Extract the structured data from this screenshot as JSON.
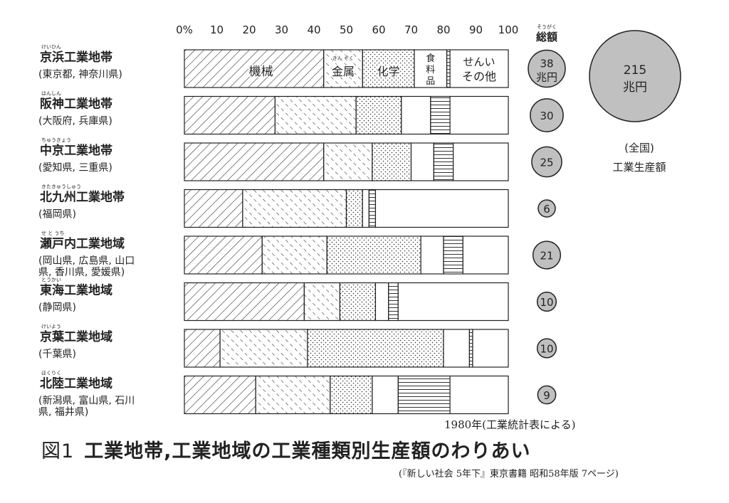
{
  "title": "図1",
  "title_text": "工業地帯,工業地域の工業種類別生産額のわりあい",
  "source_note": "1980年(工業統計表による)",
  "citation": "(『新しい社会 5年下』東京書籍 昭和58年版 7ページ)",
  "total_header": "総額",
  "total_header_ruby": "そうがく",
  "national": {
    "value": "215",
    "unit": "兆円",
    "caption": "(全国)",
    "label": "工業生産額"
  },
  "chart_data": {
    "type": "bar",
    "orientation": "horizontal-stacked-100",
    "x_ticks": [
      "0%",
      "10",
      "20",
      "30",
      "40",
      "50",
      "60",
      "70",
      "80",
      "90",
      "100"
    ],
    "xlim": [
      0,
      100
    ],
    "segment_labels": {
      "machinery": "機械",
      "metal": "金属",
      "metal_ruby": "きん ぞく",
      "chemical": "化学",
      "food": "食料品",
      "textile": "せんい",
      "other": "その他"
    },
    "categories": [
      {
        "name": "京浜工業地帯",
        "ruby": "けいひん",
        "sub": "(東京都, 神奈川県)",
        "total": "38",
        "total_unit": "兆円"
      },
      {
        "name": "阪神工業地帯",
        "ruby": "はんしん",
        "sub": "(大阪府, 兵庫県)",
        "total": "30"
      },
      {
        "name": "中京工業地帯",
        "ruby": "ちゅうきょう",
        "sub": "(愛知県, 三重県)",
        "total": "25"
      },
      {
        "name": "北九州工業地帯",
        "ruby": "きたきゅうしゅう",
        "sub": "(福岡県)",
        "total": "6"
      },
      {
        "name": "瀬戸内工業地域",
        "ruby": "せ と うち",
        "sub": "(岡山県, 広島県, 山口",
        "sub2": "県, 香川県, 愛媛県)",
        "total": "21"
      },
      {
        "name": "東海工業地域",
        "ruby": "とうかい",
        "sub": "(静岡県)",
        "total": "10"
      },
      {
        "name": "京葉工業地域",
        "ruby": "けいよう",
        "sub": "(千葉県)",
        "total": "10"
      },
      {
        "name": "北陸工業地域",
        "ruby": "ほくりく",
        "sub": "(新潟県, 富山県, 石川",
        "sub2": "県, 福井県)",
        "total": "9"
      }
    ],
    "series": [
      {
        "name": "機械",
        "values": [
          43,
          28,
          43,
          18,
          24,
          37,
          11,
          22
        ]
      },
      {
        "name": "金属",
        "values": [
          12,
          25,
          15,
          32,
          20,
          11,
          27,
          23
        ]
      },
      {
        "name": "化学",
        "values": [
          16,
          14,
          12,
          5,
          29,
          11,
          42,
          13
        ]
      },
      {
        "name": "食料品",
        "values": [
          10,
          9,
          7,
          2,
          7,
          4,
          8,
          8
        ]
      },
      {
        "name": "せんい",
        "values": [
          1,
          6,
          6,
          2,
          6,
          3,
          1,
          16
        ]
      },
      {
        "name": "その他",
        "values": [
          18,
          18,
          17,
          41,
          14,
          34,
          11,
          18
        ]
      }
    ]
  }
}
